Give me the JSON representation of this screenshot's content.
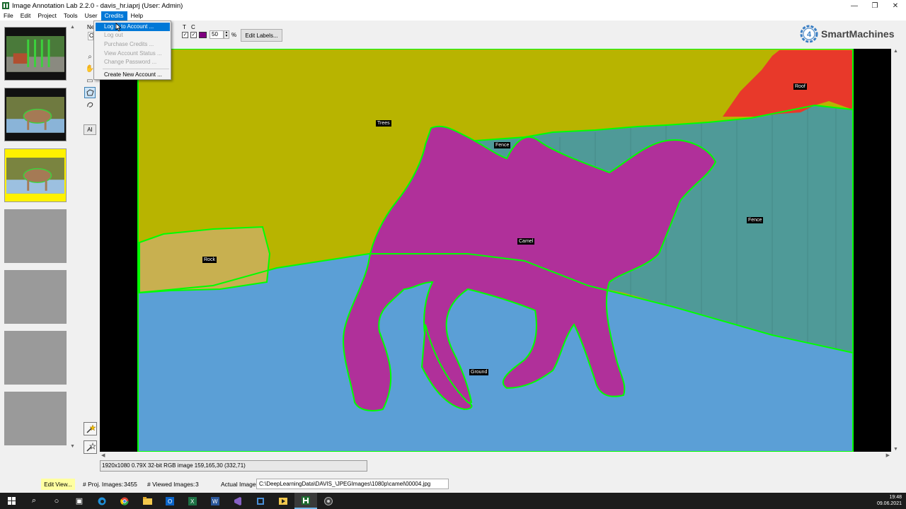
{
  "window": {
    "title": "Image Annotation Lab 2.2.0 - davis_hr.iaprj (User: Admin)",
    "minimize_glyph": "—",
    "restore_glyph": "❐",
    "close_glyph": "✕"
  },
  "menubar": {
    "items": [
      "File",
      "Edit",
      "Project",
      "Tools",
      "User",
      "Credits",
      "Help"
    ],
    "active": "Credits"
  },
  "credits_menu": {
    "items": [
      {
        "label": "Log in to Account ...",
        "enabled": true,
        "highlighted": true
      },
      {
        "label": "Log out",
        "enabled": false
      },
      {
        "label": "Purchase Credits ...",
        "enabled": false
      },
      {
        "label": "View Account Status ...",
        "enabled": false
      },
      {
        "label": "Change Password ...",
        "enabled": false
      },
      {
        "label": "Create New Account ...",
        "enabled": true
      }
    ]
  },
  "toolbar": {
    "partial_label_top": "Ne",
    "partial_label_bottom": "C",
    "col_t": "T",
    "col_c": "C",
    "check_t": "✓",
    "check_c": "✓",
    "label_color": "#800080",
    "opacity_value": "50",
    "opacity_unit": "%",
    "edit_labels": "Edit Labels..."
  },
  "logo": {
    "text": "SmartMachines",
    "badge": "4"
  },
  "tools": {
    "ai_label": "AI"
  },
  "canvas": {
    "labels": {
      "trees": "Trees",
      "roof": "Roof",
      "fence_top": "Fence",
      "fence_right": "Fence",
      "camel": "Camel",
      "rock": "Rock",
      "ground": "Ground"
    },
    "colors": {
      "trees": "#b8b400",
      "roof": "#e8392a",
      "fence": "#4f9a98",
      "camel": "#b0309a",
      "rock": "#c8b050",
      "ground": "#5b9fd6",
      "outline": "#00ff00"
    }
  },
  "image_info": "1920x1080 0.79X 32-bit RGB image 159,165,30    (332,71)",
  "statusbar": {
    "edit_view": "Edit View...",
    "proj_images_label": "# Proj. Images:",
    "proj_images_value": "3455",
    "viewed_images_label": "# Viewed Images:",
    "viewed_images_value": "3",
    "actual_image_label": "Actual Image:",
    "actual_image_path": "C:\\DeepLearningData\\DAVIS_\\JPEGImages\\1080p\\camel\\00004.jpg"
  },
  "taskbar": {
    "time": "19:48",
    "date": "09.06.2021"
  }
}
